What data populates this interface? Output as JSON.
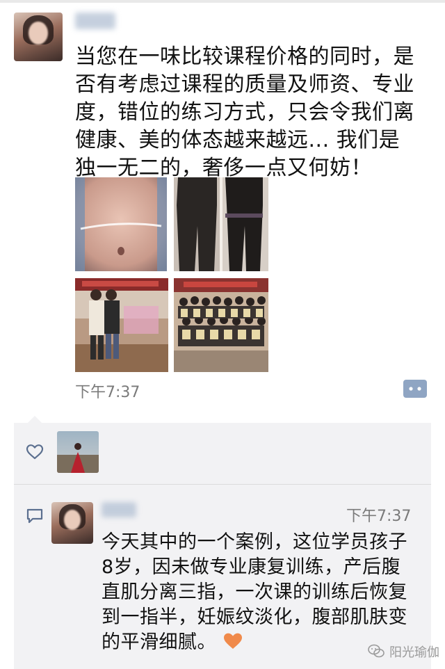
{
  "post": {
    "text": "当您在一味比较课程价格的同时，是否有考虑过课程的质量及师资、专业度，错位的练习方式，只会令我们离健康、美的体态越来越远... 我们是独一无二的，奢侈一点又何妨！",
    "time": "下午7:37",
    "more_icon": "ellipsis-comment-icon"
  },
  "likes": {
    "icon": "heart-outline-icon"
  },
  "comment": {
    "icon": "comment-bubble-icon",
    "time": "下午7:37",
    "text": "今天其中的一个案例，这位学员孩子8岁，因未做专业康复训练，产后腹直肌分离三指，一次课的训练后恢复到一指半，妊娠纹淡化，腹部肌肤变的平滑细腻。",
    "emoji": "orange-heart-icon"
  },
  "watermark": {
    "text": "阳光瑜伽",
    "icon": "wechat-logo-icon"
  },
  "colors": {
    "comment_bg": "#f2f2f4",
    "time_gray": "#7a7a7a",
    "heart_orange": "#f08a4b"
  }
}
